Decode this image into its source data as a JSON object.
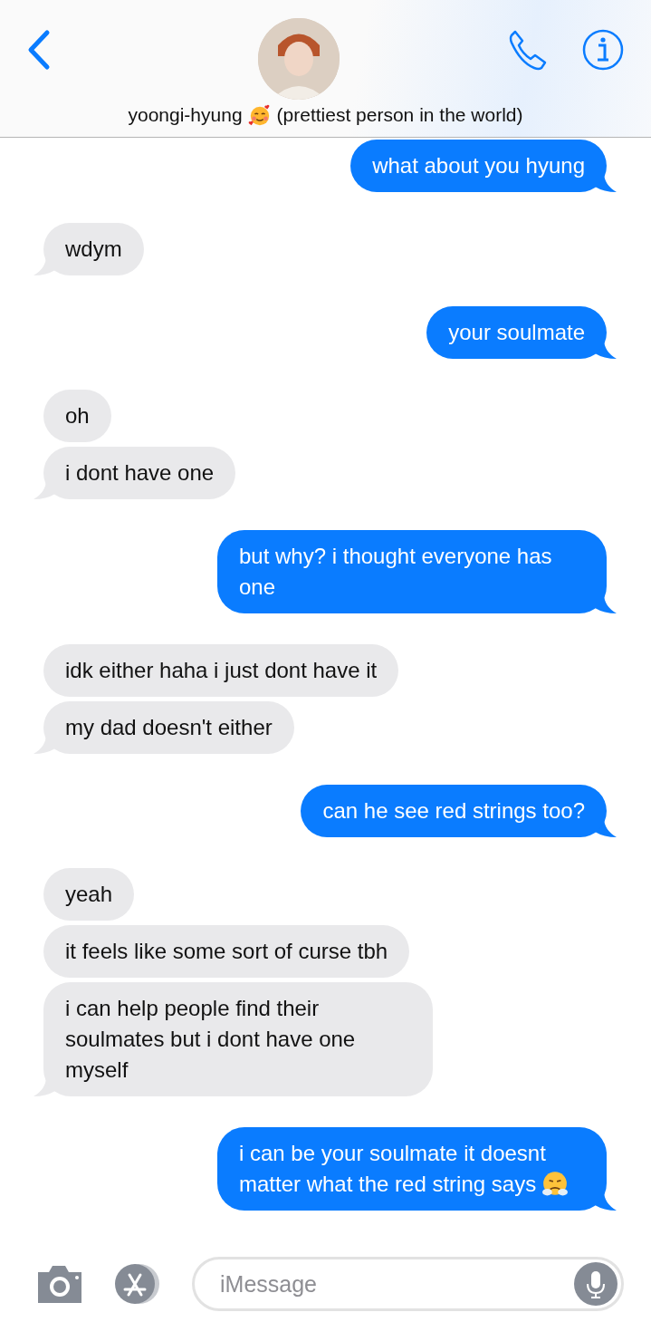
{
  "header": {
    "contact_name": "yoongi-hyung",
    "emoji": {
      "kind": "hearts"
    },
    "subtitle": "(prettiest person in the world)"
  },
  "messages": [
    {
      "kind": "sent",
      "text": "what about you hyung",
      "tail": true
    },
    {
      "kind": "received",
      "text": "wdym",
      "tail": true
    },
    {
      "kind": "sent",
      "text": "your soulmate",
      "tail": true
    },
    {
      "kind": "received",
      "text": "oh",
      "tail": false
    },
    {
      "kind": "received",
      "text": "i dont have one",
      "tail": true
    },
    {
      "kind": "sent",
      "text": "but why? i thought everyone has one",
      "tail": true
    },
    {
      "kind": "received",
      "text": "idk either haha i just dont have it",
      "tail": false
    },
    {
      "kind": "received",
      "text": "my dad doesn't either",
      "tail": true
    },
    {
      "kind": "sent",
      "text": "can he see red strings too?",
      "tail": true
    },
    {
      "kind": "received",
      "text": "yeah",
      "tail": false
    },
    {
      "kind": "received",
      "text": "it feels like some sort of curse tbh",
      "tail": false
    },
    {
      "kind": "received",
      "text": "i can help people find their soulmates but i dont have one myself",
      "tail": true
    },
    {
      "kind": "sent",
      "text": "i can be your soulmate it doesnt matter what the red string says",
      "tail": true,
      "emoji": {
        "kind": "huffing"
      }
    }
  ],
  "composer": {
    "placeholder": "iMessage"
  }
}
